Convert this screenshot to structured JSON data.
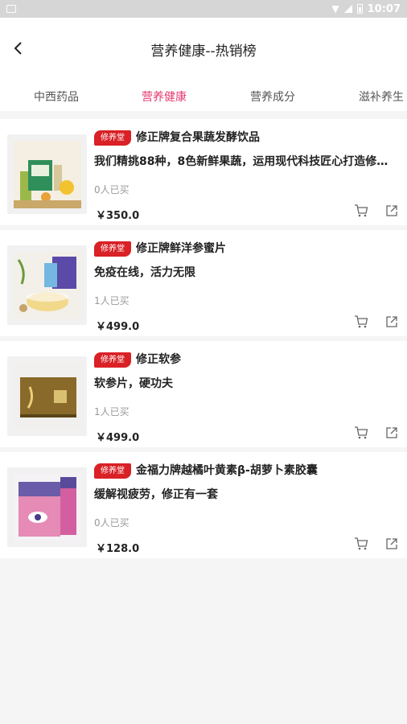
{
  "status_bar": {
    "time": "10:07"
  },
  "header": {
    "title": "营养健康--热销榜"
  },
  "tabs": [
    {
      "label": "中西药品",
      "active": false
    },
    {
      "label": "营养健康",
      "active": true
    },
    {
      "label": "营养成分",
      "active": false
    },
    {
      "label": "滋补养生",
      "active": false
    }
  ],
  "colors": {
    "accent": "#e6386f",
    "badge": "#d92126"
  },
  "products": [
    {
      "badge": "修养堂",
      "name": "修正牌复合果蔬发酵饮品",
      "desc": "我们精挑88种，8色新鲜果蔬，运用现代科技匠心打造修…",
      "sold": "0人已买",
      "price": "￥350.0"
    },
    {
      "badge": "修养堂",
      "name": "修正牌鲜洋参蜜片",
      "desc": "免疫在线，活力无限",
      "sold": "1人已买",
      "price": "￥499.0"
    },
    {
      "badge": "修养堂",
      "name": "修正软参",
      "desc": "软参片，硬功夫",
      "sold": "1人已买",
      "price": "￥499.0"
    },
    {
      "badge": "修养堂",
      "name": "金福力牌越橘叶黄素β-胡萝卜素胶囊",
      "desc": "缓解视疲劳，修正有一套",
      "sold": "0人已买",
      "price": "￥128.0"
    }
  ]
}
